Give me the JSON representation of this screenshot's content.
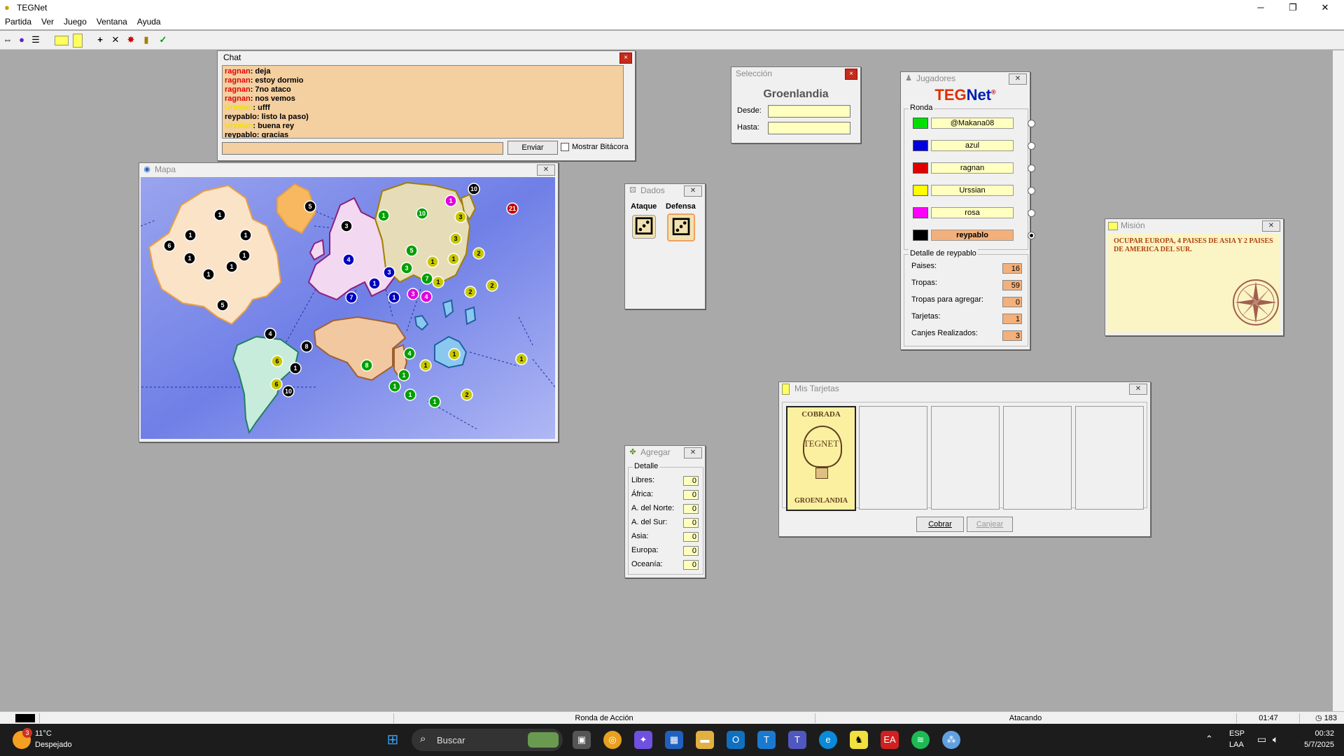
{
  "app": {
    "title": "TEGNet"
  },
  "window_controls": {
    "minimize": "─",
    "maximize": "❐",
    "close": "✕"
  },
  "menu": [
    "Partida",
    "Ver",
    "Juego",
    "Ventana",
    "Ayuda"
  ],
  "chat": {
    "title": "Chat",
    "lines": [
      {
        "player": "ragnan",
        "text": "deja",
        "color": "#e00000"
      },
      {
        "player": "ragnan",
        "text": "estoy dormio",
        "color": "#e00000"
      },
      {
        "player": "ragnan",
        "text": "7no ataco",
        "color": "#e00000"
      },
      {
        "player": "ragnan",
        "text": "nos vemos",
        "color": "#e00000"
      },
      {
        "player": "Urssian",
        "text": "ufff",
        "color": "#f0e000"
      },
      {
        "player": "reypablo",
        "text": "listo la paso)",
        "color": "#000000"
      },
      {
        "player": "Urssian",
        "text": "buena rey",
        "color": "#f0e000"
      },
      {
        "player": "reypablo",
        "text": "gracias",
        "color": "#000000"
      }
    ],
    "send_label": "Enviar",
    "log_label": "Mostrar Bitácora"
  },
  "seleccion": {
    "title": "Selección",
    "country": "Groenlandia",
    "from_label": "Desde:",
    "to_label": "Hasta:",
    "from_value": "",
    "to_value": ""
  },
  "jugadores": {
    "title": "Jugadores",
    "logo": {
      "teg": "TEG",
      "net": "Net",
      "reg": "®"
    },
    "round_label": "Ronda",
    "players": [
      {
        "name": "@Makana08",
        "color": "#00e000",
        "me": false
      },
      {
        "name": "azul",
        "color": "#0000e0",
        "me": false
      },
      {
        "name": "ragnan",
        "color": "#e00000",
        "me": false
      },
      {
        "name": "Urssian",
        "color": "#ffff00",
        "me": false
      },
      {
        "name": "rosa",
        "color": "#ff00ff",
        "me": false
      },
      {
        "name": "reypablo",
        "color": "#000000",
        "me": true
      }
    ],
    "detail_label": "Detalle de reypablo",
    "stats": [
      {
        "label": "Paises:",
        "value": "16"
      },
      {
        "label": "Tropas:",
        "value": "59"
      },
      {
        "label": "Tropas para agregar:",
        "value": "0"
      },
      {
        "label": "Tarjetas:",
        "value": "1"
      },
      {
        "label": "Canjes Realizados:",
        "value": "3"
      }
    ]
  },
  "dados": {
    "title": "Dados",
    "attack_label": "Ataque",
    "defense_label": "Defensa",
    "attack_die": "⚂",
    "defense_die": "⚂"
  },
  "agregar": {
    "title": "Agregar",
    "detail_label": "Detalle",
    "rows": [
      {
        "label": "Libres:",
        "value": "0"
      },
      {
        "label": "África:",
        "value": "0"
      },
      {
        "label": "A. del Norte:",
        "value": "0"
      },
      {
        "label": "A. del Sur:",
        "value": "0"
      },
      {
        "label": "Asia:",
        "value": "0"
      },
      {
        "label": "Europa:",
        "value": "0"
      },
      {
        "label": "Oceanía:",
        "value": "0"
      }
    ]
  },
  "mision": {
    "title": "Misión",
    "text": "OCUPAR EUROPA, 4 PAISES DE ASIA Y 2 PAISES DE AMERICA DEL SUR."
  },
  "tarjetas": {
    "title": "Mis Tarjetas",
    "card": {
      "status": "COBRADA",
      "brand": "TEGNET",
      "country": "GROENLANDIA"
    },
    "collect_label": "Cobrar",
    "exchange_label": "Canjear"
  },
  "mapa": {
    "title": "Mapa"
  },
  "map_tokens": [
    {
      "n": "1",
      "c": "#000"
    },
    {
      "n": "5",
      "c": "#000"
    },
    {
      "n": "1",
      "c": "#000"
    },
    {
      "n": "6",
      "c": "#000"
    },
    {
      "n": "1",
      "c": "#000"
    },
    {
      "n": "1",
      "c": "#000"
    },
    {
      "n": "1",
      "c": "#000"
    },
    {
      "n": "1",
      "c": "#000"
    },
    {
      "n": "1",
      "c": "#000"
    },
    {
      "n": "5",
      "c": "#000"
    },
    {
      "n": "3",
      "c": "#000"
    },
    {
      "n": "4",
      "c": "#000"
    },
    {
      "n": "8",
      "c": "#000"
    },
    {
      "n": "6",
      "c": "#c8c800"
    },
    {
      "n": "1",
      "c": "#000"
    },
    {
      "n": "6",
      "c": "#c8c800"
    },
    {
      "n": "10",
      "c": "#000"
    },
    {
      "n": "1",
      "c": "#00a000"
    },
    {
      "n": "5",
      "c": "#00a000"
    },
    {
      "n": "4",
      "c": "#0000c0"
    },
    {
      "n": "3",
      "c": "#0000c0"
    },
    {
      "n": "1",
      "c": "#0000c0"
    },
    {
      "n": "3",
      "c": "#00a000"
    },
    {
      "n": "7",
      "c": "#0000c0"
    },
    {
      "n": "1",
      "c": "#0000c0"
    },
    {
      "n": "7",
      "c": "#00a000"
    },
    {
      "n": "3",
      "c": "#e000e0"
    },
    {
      "n": "4",
      "c": "#e000e0"
    },
    {
      "n": "1",
      "c": "#c8c800"
    },
    {
      "n": "1",
      "c": "#e000e0"
    },
    {
      "n": "3",
      "c": "#c8c800"
    },
    {
      "n": "10",
      "c": "#000"
    },
    {
      "n": "21",
      "c": "#c00000"
    },
    {
      "n": "10",
      "c": "#00a000"
    },
    {
      "n": "3",
      "c": "#c8c800"
    },
    {
      "n": "2",
      "c": "#c8c800"
    },
    {
      "n": "1",
      "c": "#c8c800"
    },
    {
      "n": "1",
      "c": "#c8c800"
    },
    {
      "n": "2",
      "c": "#c8c800"
    },
    {
      "n": "2",
      "c": "#c8c800"
    },
    {
      "n": "4",
      "c": "#00a000"
    },
    {
      "n": "8",
      "c": "#00a000"
    },
    {
      "n": "1",
      "c": "#00a000"
    },
    {
      "n": "1",
      "c": "#00a000"
    },
    {
      "n": "1",
      "c": "#00a000"
    },
    {
      "n": "1",
      "c": "#00a000"
    },
    {
      "n": "1",
      "c": "#c8c800"
    },
    {
      "n": "1",
      "c": "#c8c800"
    },
    {
      "n": "1",
      "c": "#c8c800"
    },
    {
      "n": "2",
      "c": "#c8c800"
    }
  ],
  "status": {
    "phase": "Ronda de Acción",
    "state": "Atacando",
    "time": "01:47",
    "count": "183"
  },
  "taskbar": {
    "weather_temp": "11°C",
    "weather_desc": "Despejado",
    "weather_badge": "3",
    "search_placeholder": "Buscar",
    "lang": "ESP",
    "layout": "LAA",
    "clock_time": "00:32",
    "clock_date": "5/7/2025"
  }
}
